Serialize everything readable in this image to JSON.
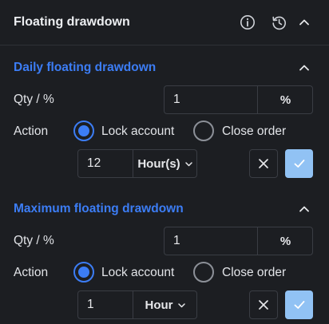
{
  "panel": {
    "title": "Floating drawdown",
    "icons": [
      "info-icon",
      "history-icon",
      "chevron-up-icon"
    ]
  },
  "colors": {
    "accent": "#3c7df5",
    "confirm_button": "#91c2f4",
    "background": "#1c1e22"
  },
  "sections": [
    {
      "title": "Daily floating drawdown",
      "qty_label": "Qty / %",
      "qty_value": "1",
      "qty_unit": "%",
      "action_label": "Action",
      "options": [
        "Lock account",
        "Close order"
      ],
      "selected_option": "Lock account",
      "duration_value": "12",
      "duration_unit": "Hour(s)"
    },
    {
      "title": "Maximum floating drawdown",
      "qty_label": "Qty / %",
      "qty_value": "1",
      "qty_unit": "%",
      "action_label": "Action",
      "options": [
        "Lock account",
        "Close order"
      ],
      "selected_option": "Lock account",
      "duration_value": "1",
      "duration_unit": "Hour"
    }
  ]
}
